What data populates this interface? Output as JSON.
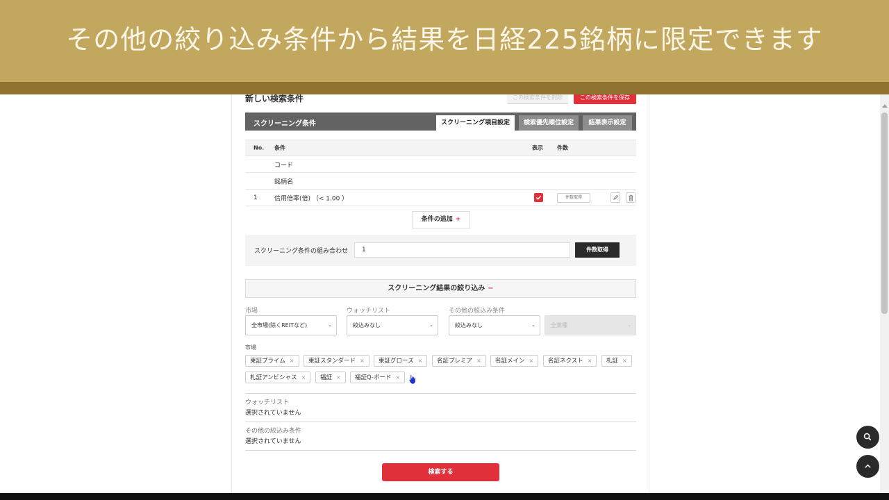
{
  "banner": {
    "text": "その他の絞り込み条件から結果を日経225銘柄に限定できます"
  },
  "header": {
    "title": "新しい検索条件",
    "secondary_button": "この検索条件を削除",
    "save_button": "この検索条件を保存"
  },
  "screening": {
    "title": "スクリーニング条件",
    "tabs": [
      "スクリーニング項目設定",
      "検索優先順位設定",
      "結果表示設定"
    ],
    "columns": {
      "no": "No.",
      "condition": "条件",
      "display": "表示",
      "count": "件数"
    },
    "rows": [
      {
        "no": "",
        "condition": "コード"
      },
      {
        "no": "",
        "condition": "銘柄名"
      },
      {
        "no": "1",
        "condition": "信用倍率(倍) （< 1.00 ）",
        "count_button": "件数取得"
      }
    ],
    "add_button": "条件の追加",
    "add_symbol": "+",
    "combination_label": "スクリーニング条件の組み合わせ",
    "combination_value": "1",
    "count_button": "件数取得"
  },
  "filter": {
    "title": "スクリーニング結果の絞り込み",
    "collapse_symbol": "−",
    "market_label": "市場",
    "market_value": "全市場(除くREITなど)",
    "watchlist_label": "ウォッチリスト",
    "watchlist_value": "絞込みなし",
    "other_label": "その他の絞込み条件",
    "other_value": "絞込みなし",
    "fourth_value": "全業種",
    "markets_heading": "市場",
    "market_tags": [
      "東証プライム",
      "東証スタンダード",
      "東証グロース",
      "名証プレミア",
      "名証メイン",
      "名証ネクスト",
      "札証",
      "札証アンビシャス",
      "福証",
      "福証Q-ボード"
    ],
    "tag_remove_symbol": "×",
    "watchlist_heading": "ウォッチリスト",
    "watchlist_status": "選択されていません",
    "other_heading": "その他の絞込み条件",
    "other_status": "選択されていません"
  },
  "search_button": "検索する",
  "icons": {
    "check": "check-icon",
    "edit": "pencil-icon",
    "delete": "trash-icon",
    "search": "search-icon",
    "top": "chevron-up-icon"
  },
  "colors": {
    "accent": "#e0303a",
    "banner": "#c2a85e",
    "dark": "#2a2a2a"
  }
}
